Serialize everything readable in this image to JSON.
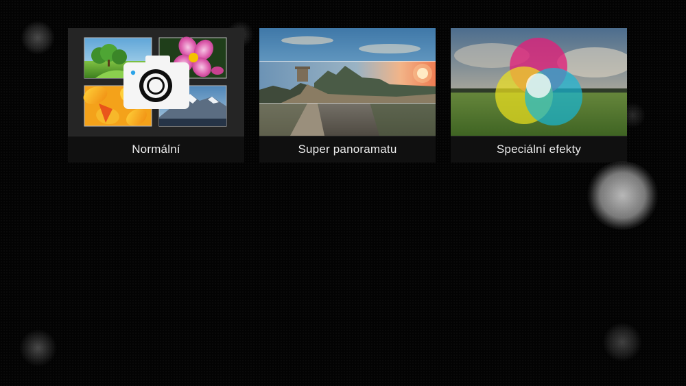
{
  "modes": [
    {
      "id": "normal",
      "label": "Normální",
      "icon": "camera-icon"
    },
    {
      "id": "panorama",
      "label": "Super panoramatu",
      "icon": "panorama-thumbnail"
    },
    {
      "id": "effects",
      "label": "Speciální efekty",
      "icon": "color-effects-thumbnail"
    }
  ],
  "colors": {
    "background": "#030303",
    "card_background": "#1b1b1b",
    "label_bar": "#101010",
    "label_text": "#ececec"
  }
}
